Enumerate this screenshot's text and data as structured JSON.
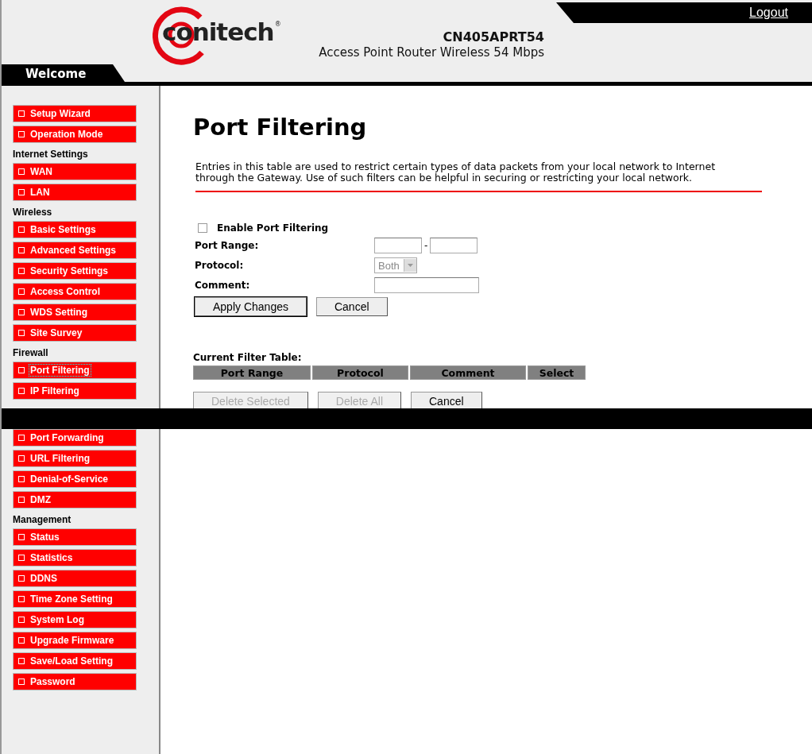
{
  "header": {
    "brand": "conitech",
    "brand_mark": "®",
    "model": "CN405APRT54",
    "subtitle": "Access Point Router Wireless 54 Mbps",
    "logout": "Logout",
    "welcome": "Welcome"
  },
  "sidebar": [
    {
      "items": [
        {
          "label": "Setup Wizard",
          "selected": false
        },
        {
          "label": "Operation Mode",
          "selected": false
        }
      ]
    },
    {
      "heading": "Internet Settings",
      "items": [
        {
          "label": "WAN",
          "selected": false
        },
        {
          "label": "LAN",
          "selected": false
        }
      ]
    },
    {
      "heading": "Wireless",
      "items": [
        {
          "label": "Basic Settings",
          "selected": false
        },
        {
          "label": "Advanced Settings",
          "selected": false
        },
        {
          "label": "Security Settings",
          "selected": false
        },
        {
          "label": "Access Control",
          "selected": false
        },
        {
          "label": "WDS Setting",
          "selected": false
        },
        {
          "label": "Site Survey",
          "selected": false
        }
      ]
    },
    {
      "heading": "Firewall",
      "items": [
        {
          "label": "Port Filtering",
          "selected": true
        },
        {
          "label": "IP Filtering",
          "selected": false
        },
        {
          "label": "Port Forwarding",
          "selected": false,
          "covered_above": true
        },
        {
          "label": "URL Filtering",
          "selected": false
        },
        {
          "label": "Denial-of-Service",
          "selected": false
        },
        {
          "label": "DMZ",
          "selected": false
        }
      ]
    },
    {
      "heading": "Management",
      "items": [
        {
          "label": "Status",
          "selected": false
        },
        {
          "label": "Statistics",
          "selected": false
        },
        {
          "label": "DDNS",
          "selected": false
        },
        {
          "label": "Time Zone Setting",
          "selected": false
        },
        {
          "label": "System Log",
          "selected": false
        },
        {
          "label": "Upgrade Firmware",
          "selected": false
        },
        {
          "label": "Save/Load Setting",
          "selected": false
        },
        {
          "label": "Password",
          "selected": false
        }
      ]
    }
  ],
  "content": {
    "title": "Port Filtering",
    "description": "Entries in this table are used to restrict certain types of data packets from your local network to Internet through the Gateway. Use of such filters can be helpful in securing or restricting your local network.",
    "enable": {
      "label": "Enable Port Filtering",
      "checked": false
    },
    "port_range": {
      "label": "Port Range:",
      "separator": "-"
    },
    "protocol": {
      "label": "Protocol:",
      "value": "Both",
      "disabled": true
    },
    "comment": {
      "label": "Comment:"
    },
    "buttons": [
      {
        "label": "Apply Changes",
        "default": true
      },
      {
        "label": "Cancel",
        "default": false
      }
    ],
    "table": {
      "title": "Current Filter Table:",
      "columns": [
        "Port Range",
        "Protocol",
        "Comment",
        "Select"
      ]
    },
    "table_buttons": [
      {
        "label": "Delete Selected",
        "disabled": true
      },
      {
        "label": "Delete All",
        "disabled": true
      },
      {
        "label": "Cancel",
        "disabled": false
      }
    ]
  }
}
